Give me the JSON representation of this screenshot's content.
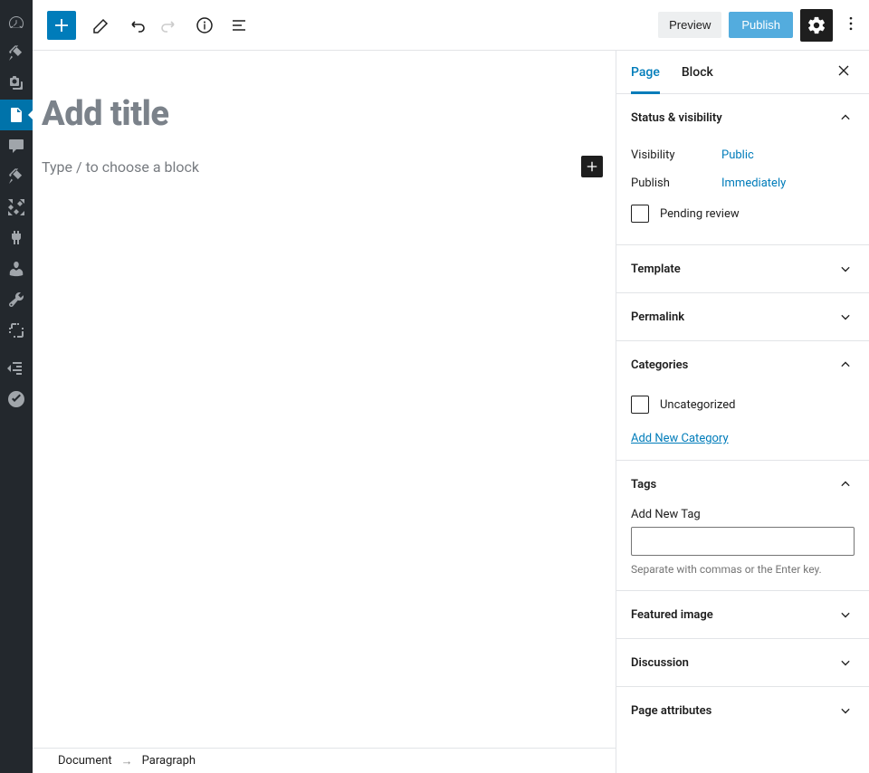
{
  "toolbar": {
    "preview_label": "Preview",
    "publish_label": "Publish"
  },
  "editor": {
    "title_placeholder": "Add title",
    "paragraph_placeholder": "Type / to choose a block"
  },
  "breadcrumb": {
    "root": "Document",
    "sep": "→",
    "current": "Paragraph"
  },
  "sidebar": {
    "tabs": {
      "page": "Page",
      "block": "Block"
    },
    "panels": {
      "status": {
        "title": "Status & visibility",
        "visibility_label": "Visibility",
        "visibility_value": "Public",
        "publish_label": "Publish",
        "publish_value": "Immediately",
        "pending_label": "Pending review"
      },
      "template": {
        "title": "Template"
      },
      "permalink": {
        "title": "Permalink"
      },
      "categories": {
        "title": "Categories",
        "uncategorized_label": "Uncategorized",
        "add_link": "Add New Category"
      },
      "tags": {
        "title": "Tags",
        "add_label": "Add New Tag",
        "help": "Separate with commas or the Enter key."
      },
      "featured_image": {
        "title": "Featured image"
      },
      "discussion": {
        "title": "Discussion"
      },
      "page_attributes": {
        "title": "Page attributes"
      }
    }
  }
}
